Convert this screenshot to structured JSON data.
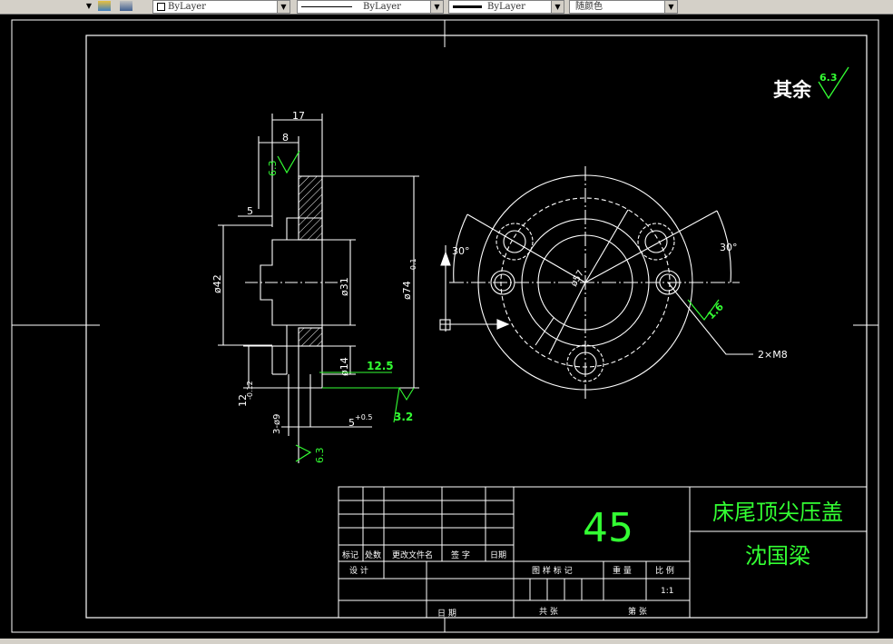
{
  "toolbar": {
    "layer_color": "ByLayer",
    "linetype": "ByLayer",
    "lineweight": "ByLayer",
    "plot_style": "随颜色"
  },
  "drawing": {
    "note_label": "其余",
    "note_roughness": "6.3",
    "dims": {
      "d17": "17",
      "d8": "8",
      "d5": "5",
      "r63_top": "6.3",
      "phi42": "ø42",
      "phi31": "ø31",
      "phi74": "ø74",
      "phi74_tol": "-0.1",
      "phi14": "ø14",
      "r125": "12.5",
      "r32": "3.2",
      "d12": "12",
      "d12_tol": "-0.12",
      "d3phi": "3-ø9",
      "d5b": "5",
      "d5b_tol": "+0.5",
      "r63_bot": "6.3",
      "ang30_left": "30°",
      "ang30_right": "30°",
      "r16": "1.6",
      "holes": "2×M8",
      "phi57": "ø57"
    }
  },
  "title_block": {
    "material": "45",
    "part_name": "床尾顶尖压盖",
    "designer_name": "沈国梁",
    "headers": [
      "标记",
      "处数",
      "更改文件名",
      "签 字",
      "日期"
    ],
    "design": "设 计",
    "date": "日 期",
    "stage_mark": "图 样 标 记",
    "weight": "重 量",
    "scale_label": "比 例",
    "scale": "1:1",
    "total_sheets": "共 张",
    "sheet_no": "第 张"
  }
}
